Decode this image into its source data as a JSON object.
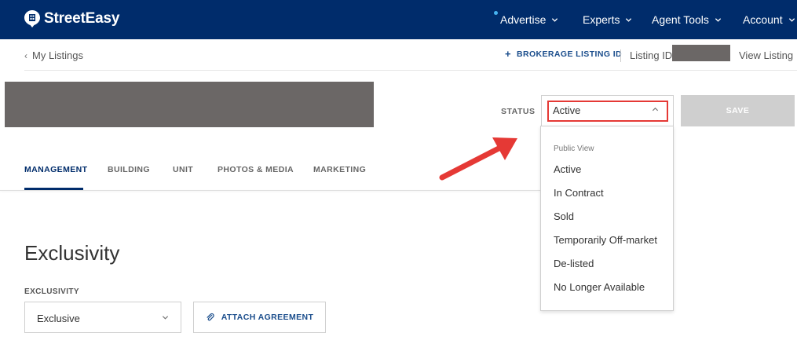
{
  "header": {
    "brand": "StreetEasy",
    "nav": [
      {
        "label": "Advertise"
      },
      {
        "label": "Experts"
      },
      {
        "label": "Agent Tools"
      },
      {
        "label": "Account"
      }
    ]
  },
  "subbar": {
    "back_label": "My Listings",
    "brokerage_label": "BROKERAGE LISTING ID",
    "listing_id_label": "Listing ID",
    "view_listing_label": "View Listing"
  },
  "status": {
    "label": "STATUS",
    "selected": "Active",
    "save_label": "SAVE",
    "dropdown": {
      "group_label": "Public View",
      "options": [
        "Active",
        "In Contract",
        "Sold",
        "Temporarily Off-market",
        "De-listed",
        "No Longer Available"
      ]
    }
  },
  "tabs": [
    {
      "label": "MANAGEMENT"
    },
    {
      "label": "BUILDING"
    },
    {
      "label": "UNIT"
    },
    {
      "label": "PHOTOS & MEDIA"
    },
    {
      "label": "MARKETING"
    }
  ],
  "exclusivity": {
    "section_title": "Exclusivity",
    "field_label": "EXCLUSIVITY",
    "selected": "Exclusive",
    "attach_label": "ATTACH AGREEMENT"
  },
  "colors": {
    "nav_bg": "#002c6b",
    "highlight": "#e53935",
    "link": "#1a4d8c",
    "save_disabled": "#cfcfcf",
    "redaction": "#6b6766"
  }
}
